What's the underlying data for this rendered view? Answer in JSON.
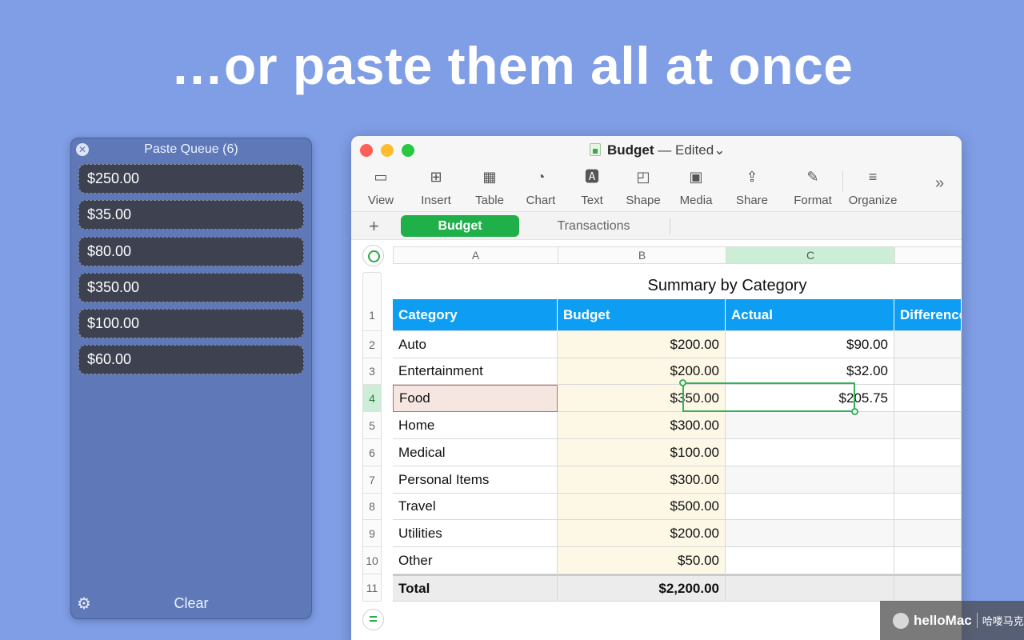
{
  "headline": "…or paste them all at once",
  "paste_queue": {
    "title": "Paste Queue (6)",
    "close_glyph": "✕",
    "items": [
      "$250.00",
      "$35.00",
      "$80.00",
      "$350.00",
      "$100.00",
      "$60.00"
    ],
    "clear_label": "Clear",
    "settings_glyph": "⚙"
  },
  "window": {
    "doc_name": "Budget",
    "doc_status": "Edited",
    "toolbar": [
      {
        "label": "View",
        "icon": "sidebar-icon",
        "glyph": "▭"
      },
      {
        "label": "Insert",
        "icon": "insert-icon",
        "glyph": "⊞"
      },
      {
        "label": "Table",
        "icon": "table-icon",
        "glyph": "▦"
      },
      {
        "label": "Chart",
        "icon": "chart-icon",
        "glyph": "◔"
      },
      {
        "label": "Text",
        "icon": "text-icon",
        "glyph": "🅰"
      },
      {
        "label": "Shape",
        "icon": "shape-icon",
        "glyph": "◰"
      },
      {
        "label": "Media",
        "icon": "media-icon",
        "glyph": "▣"
      },
      {
        "label": "Share",
        "icon": "share-icon",
        "glyph": "⇪"
      },
      {
        "label": "Format",
        "icon": "paintbrush-icon",
        "glyph": "✎"
      },
      {
        "label": "Organize",
        "icon": "organize-icon",
        "glyph": "≡"
      }
    ],
    "more_glyph": "»",
    "sheets": {
      "add_glyph": "+",
      "active": "Budget",
      "other": "Transactions"
    },
    "columns": [
      "A",
      "B",
      "C"
    ],
    "table": {
      "title": "Summary by Category",
      "headers": [
        "Category",
        "Budget",
        "Actual",
        "Difference"
      ],
      "rows": [
        {
          "num": "1"
        },
        {
          "num": "2",
          "category": "Auto",
          "budget": "$200.00",
          "actual": "$90.00"
        },
        {
          "num": "3",
          "category": "Entertainment",
          "budget": "$200.00",
          "actual": "$32.00"
        },
        {
          "num": "4",
          "category": "Food",
          "budget": "$350.00",
          "actual": "$205.75"
        },
        {
          "num": "5",
          "category": "Home",
          "budget": "$300.00",
          "actual": ""
        },
        {
          "num": "6",
          "category": "Medical",
          "budget": "$100.00",
          "actual": ""
        },
        {
          "num": "7",
          "category": "Personal Items",
          "budget": "$300.00",
          "actual": ""
        },
        {
          "num": "8",
          "category": "Travel",
          "budget": "$500.00",
          "actual": ""
        },
        {
          "num": "9",
          "category": "Utilities",
          "budget": "$200.00",
          "actual": ""
        },
        {
          "num": "10",
          "category": "Other",
          "budget": "$50.00",
          "actual": ""
        },
        {
          "num": "11",
          "category": "Total",
          "budget": "$2,200.00",
          "actual": ""
        }
      ]
    },
    "bottom_glyph": "="
  },
  "watermark": {
    "brand": "helloMac",
    "sub": "哈喽马克"
  },
  "colors": {
    "background": "#7f9ee6",
    "header_blue": "#0d9ef3",
    "accent_green": "#1fb04a"
  }
}
